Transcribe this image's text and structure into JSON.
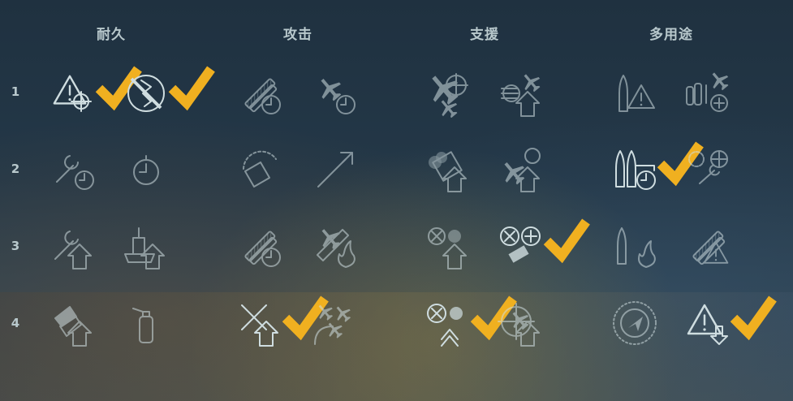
{
  "categories": [
    {
      "label": "耐久",
      "skills": [
        [
          {
            "icon": "warning-crosshair-icon",
            "selected": true
          },
          {
            "icon": "no-fire-shield-icon",
            "selected": true
          }
        ],
        [
          {
            "icon": "wrench-timer-icon",
            "selected": false
          },
          {
            "icon": "stopwatch-icon",
            "selected": false
          }
        ],
        [
          {
            "icon": "wrench-upgrade-icon",
            "selected": false
          },
          {
            "icon": "ship-upgrade-icon",
            "selected": false
          }
        ],
        [
          {
            "icon": "shell-upgrade-icon",
            "selected": false
          },
          {
            "icon": "extinguisher-icon",
            "selected": false
          }
        ]
      ]
    },
    {
      "label": "攻击",
      "skills": [
        [
          {
            "icon": "guns-timer-icon",
            "selected": false
          },
          {
            "icon": "plane-timer-icon",
            "selected": false
          }
        ],
        [
          {
            "icon": "turret-arc-icon",
            "selected": false
          },
          {
            "icon": "shell-range-icon",
            "selected": false
          }
        ],
        [
          {
            "icon": "torpedo-timer-icon",
            "selected": false
          },
          {
            "icon": "plane-fire-icon",
            "selected": false
          }
        ],
        [
          {
            "icon": "crossed-planes-upgrade-icon",
            "selected": true
          },
          {
            "icon": "planes-wave-icon",
            "selected": false
          }
        ]
      ]
    },
    {
      "label": "支援",
      "skills": [
        [
          {
            "icon": "aircraft-crosshair-icon",
            "selected": false
          },
          {
            "icon": "aa-upgrade-icon",
            "selected": false
          }
        ],
        [
          {
            "icon": "smoke-upgrade-icon",
            "selected": false
          },
          {
            "icon": "fighter-upgrade-icon",
            "selected": false
          }
        ],
        [
          {
            "icon": "aa-burst-upgrade-icon",
            "selected": false
          },
          {
            "icon": "aa-heal-icon",
            "selected": true
          }
        ],
        [
          {
            "icon": "aa-double-upgrade-icon",
            "selected": true
          },
          {
            "icon": "aa-target-icon",
            "selected": false
          }
        ]
      ]
    },
    {
      "label": "多用途",
      "skills": [
        [
          {
            "icon": "torpedo-warning-icon",
            "selected": false
          },
          {
            "icon": "consumable-heal-icon",
            "selected": false
          }
        ],
        [
          {
            "icon": "torpedo-reload-icon",
            "selected": true
          },
          {
            "icon": "gears-wrench-icon",
            "selected": false
          }
        ],
        [
          {
            "icon": "torpedo-fire-icon",
            "selected": false
          },
          {
            "icon": "guns-warning-icon",
            "selected": false
          }
        ],
        [
          {
            "icon": "radar-detection-icon",
            "selected": false
          },
          {
            "icon": "warning-download-icon",
            "selected": true
          }
        ]
      ]
    }
  ],
  "tiers": [
    "1",
    "2",
    "3",
    "4"
  ],
  "colors": {
    "icon": "#cfdde0",
    "check": "#f0b020",
    "header": "#b8c8cc"
  }
}
